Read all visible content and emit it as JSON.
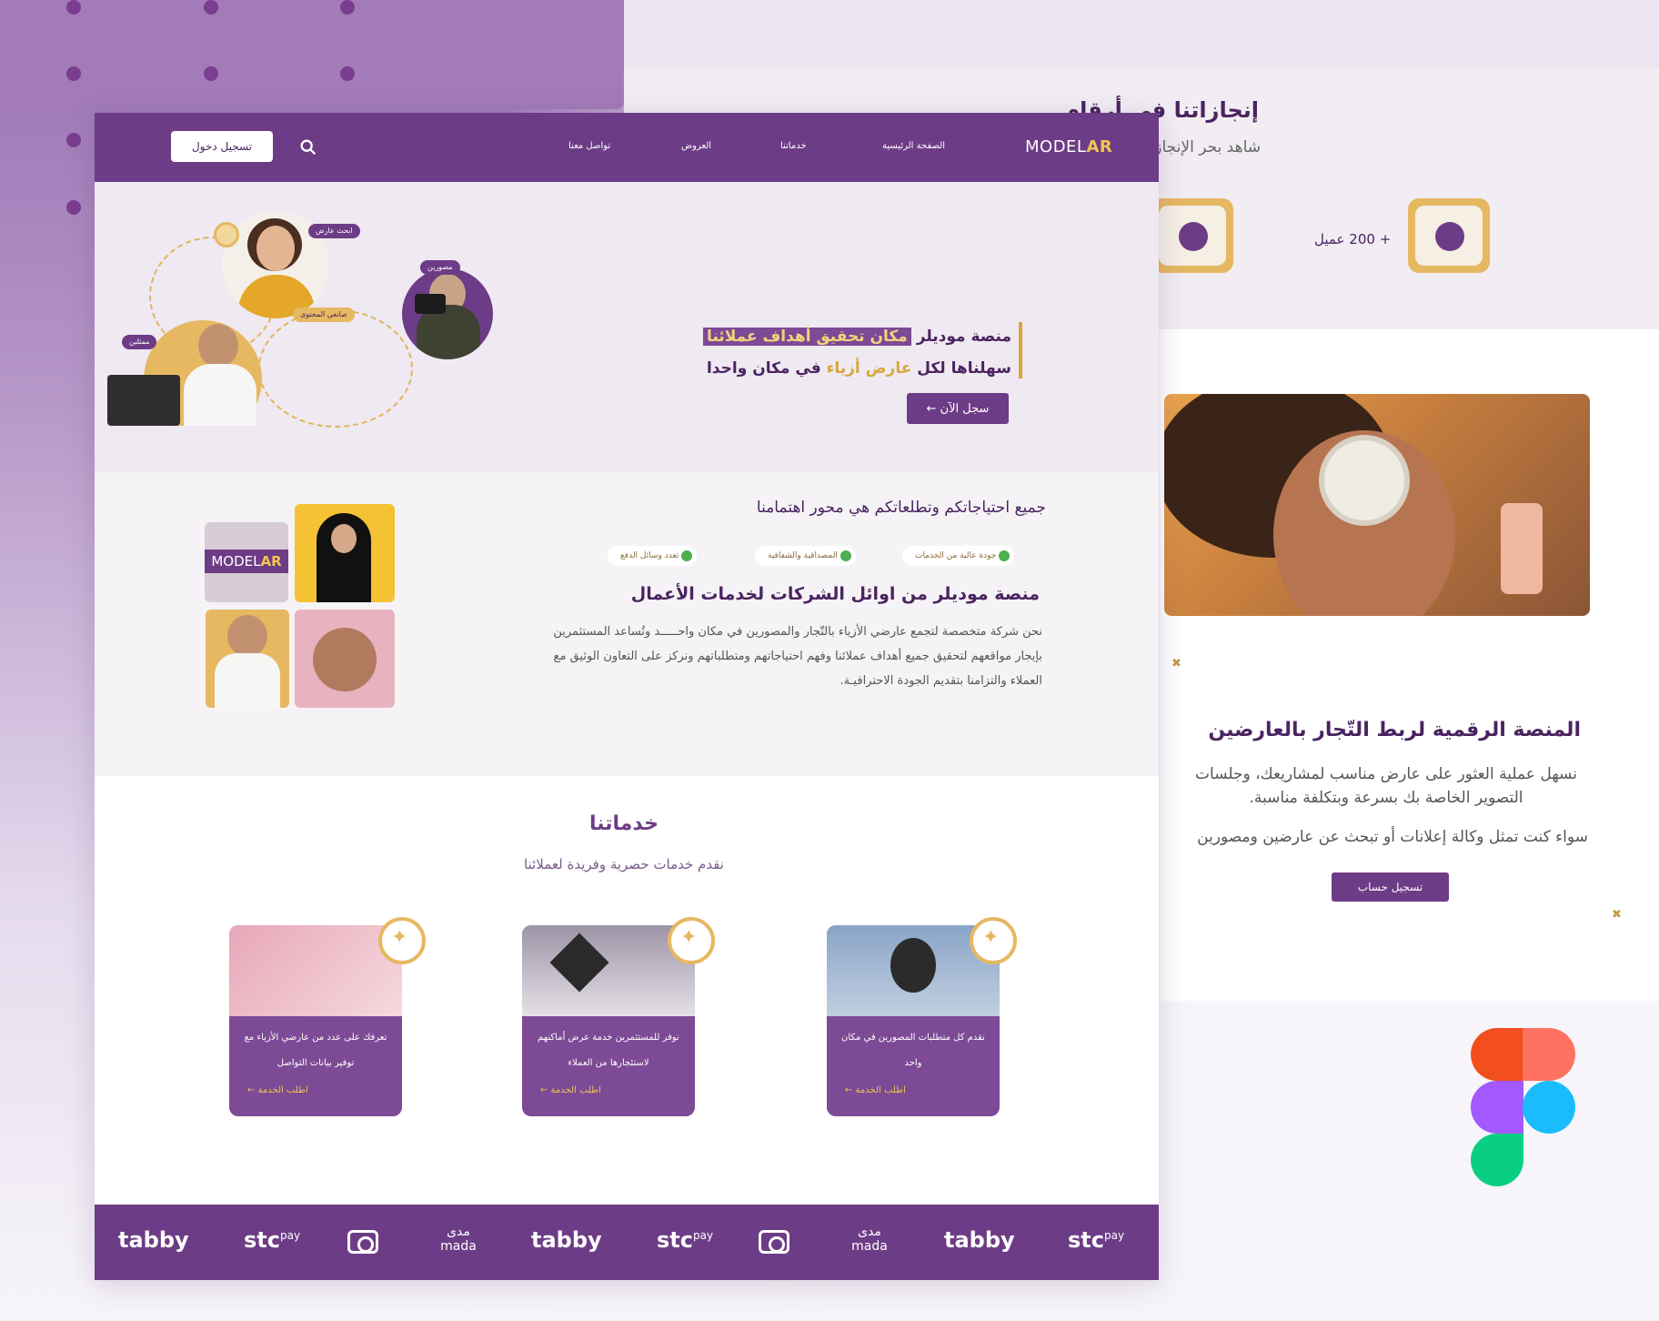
{
  "colors": {
    "brand": "#6d3c86",
    "accent": "#e6b862",
    "hero_bg": "#efe9f2"
  },
  "nav": {
    "logo_main": "MODEL",
    "logo_accent": "AR",
    "links": [
      "الصفحة الرئيسية",
      "خدماتنا",
      "العروض",
      "تواصل معنا"
    ],
    "login": "تسجيل دخول",
    "search_icon": "search-icon"
  },
  "hero": {
    "line1_prefix": "منصة موديلر",
    "line1_highlight": "مكان تحقيق أهداف عملائنا",
    "line2_a": "سهلناها لكل",
    "line2_gold": "عارض أزياء",
    "line2_b": "في مكان واحدا",
    "cta": "سجل الآن ←",
    "tags": [
      "ابحث عارض",
      "مصورين",
      "ممثلين",
      "صانعي المحتوى"
    ]
  },
  "about": {
    "heading": "جميع احتياجاتكم وتطلعاتكم هي محور اهتمامنا",
    "chips": [
      "جودة عالية من الخدمات",
      "المصداقية والشفافية",
      "تعدد وسائل الدفع"
    ],
    "title": "منصة موديلر من اوائل الشركات لخدمات الأعمال",
    "paragraph": "نحن شركة متخصصة لتجمع عارضي الأزياء بالتّجار والمصورين في مكان واحـــــد وتُساعد المستثمرين بإيجار مواقعهم لتحقيق جميع أهداف عملائنا وفهم احتياجاتهم ومتطلباتهم ونركز على التعاون الوثيق مع العملاء والتزامنا بتقديم الجودة الاحترافيـة.",
    "logo_main": "MODEL",
    "logo_accent": "AR"
  },
  "services": {
    "title": "خدماتنا",
    "subtitle": "نقدم خدمات حصرية وفريدة لعملائنا",
    "cards": [
      {
        "text": "نقدم كل متطلبات المصورين في مكان واحد",
        "link": "اطلب الخدمة ←"
      },
      {
        "text": "نوفر للمستثمرين خدمة عرض أماكنهم لاستئجارها من العملاء",
        "link": "اطلب الخدمة ←"
      },
      {
        "text": "تعرفك على عدد من عارضي الأزياء مع توفير بيانات التواصل",
        "link": "اطلب الخدمة ←"
      }
    ],
    "spark_icon": "sparkle-icon"
  },
  "payments": {
    "tabby": "tabby",
    "stc": "stc",
    "stc_pay": "pay",
    "mada_ar": "مدى",
    "mada_en": "mada"
  },
  "back": {
    "stats_title": "إنجازاتنا في أرقام",
    "stats_sub": "شاهد بحر الإنجازات",
    "stat_count": "+ 200 عميل",
    "right_title": "المنصة الرقمية لربط التّجار بالعارضين",
    "right_p1": "نسهل عملية العثور على عارض مناسب لمشاريعك، وجلسات التصوير الخاصة بك بسرعة وبتكلفة مناسبة.",
    "right_p2": "سواء كنت تمثل وكالة إعلانات أو تبحث عن عارضين ومصورين",
    "right_btn": "تسجيل حساب"
  }
}
